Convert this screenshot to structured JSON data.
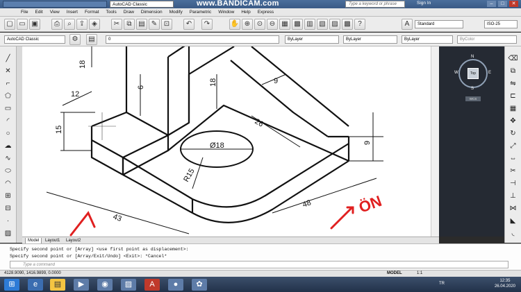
{
  "window": {
    "workspace": "AutoCAD Classic",
    "watermark": "www.BANDICAM.com",
    "search_placeholder": "Type a keyword or phrase",
    "sign_in": "Sign In",
    "win_buttons": [
      "–",
      "□",
      "✕"
    ]
  },
  "menu": [
    "File",
    "Edit",
    "View",
    "Insert",
    "Format",
    "Tools",
    "Draw",
    "Dimension",
    "Modify",
    "Parametric",
    "Window",
    "Help",
    "Express"
  ],
  "toolbar": {
    "text_style": "Standard",
    "dim_style": "ISO-25",
    "workspace2": "AutoCAD Classic",
    "layer": "0",
    "color": "ByLayer",
    "linetype": "ByLayer",
    "lineweight": "ByLayer",
    "plotstyle": "ByColor"
  },
  "viewcube": {
    "top": "Top",
    "north": "N",
    "south": "S",
    "east": "E",
    "west": "W",
    "wcs": "WCS"
  },
  "drawing": {
    "dims": [
      "18",
      "6",
      "18",
      "9",
      "12",
      "15",
      "26",
      "Ø18",
      "R15",
      "9",
      "43",
      "48"
    ],
    "annotation_right": "ÖN"
  },
  "tabs": [
    "Model",
    "Layout1",
    "Layout2"
  ],
  "command": {
    "line1": "Specify second point or [Array] <use first point as displacement>:",
    "line2": "Specify second point or [Array/Exit/Undo] <Exit>: *Cancel*",
    "input_placeholder": "Type a command"
  },
  "status": {
    "coords": "4128.9090, 1416.9899, 0.0000",
    "model": "MODEL",
    "scale": "1:1"
  },
  "taskbar": {
    "lang": "TR",
    "time": "12:35",
    "date": "26.04.2020"
  }
}
